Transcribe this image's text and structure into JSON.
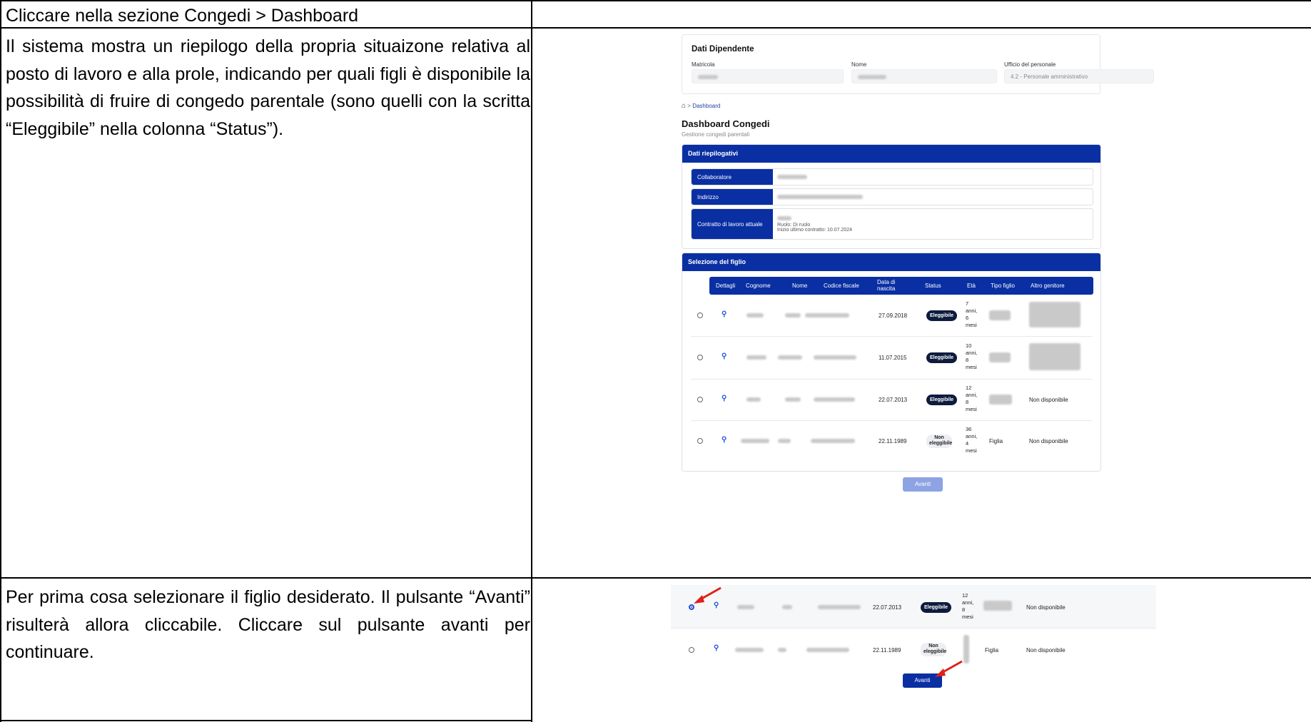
{
  "doc": {
    "header_instruction": "Cliccare nella sezione Congedi > Dashboard",
    "step1_text": "Il sistema mostra un riepilogo della propria situaizone relativa al posto di lavoro e alla prole, indicando per quali figli è disponibile la possibilità di fruire di congedo parentale (sono quelli con la scritta “Eleggibile” nella colonna “Status”).",
    "step2_text": "Per prima cosa selezionare il figlio desiderato. Il pulsante “Avanti” risulterà allora cliccabile. Cliccare sul pulsante avanti per continuare."
  },
  "employee": {
    "title": "Dati Dipendente",
    "matricola_label": "Matricola",
    "nome_label": "Nome",
    "ufficio_label": "Ufficio del personale",
    "ufficio_value": "4.2 - Personale amministrativo"
  },
  "breadcrumb": {
    "current": "Dashboard"
  },
  "page": {
    "title": "Dashboard Congedi",
    "subtitle": "Gestione congedi parentali"
  },
  "summary": {
    "title": "Dati riepilogativi",
    "collaboratore_label": "Collaboratore",
    "indirizzo_label": "Indirizzo",
    "contratto_label": "Contratto di lavoro attuale",
    "ruolo": "Ruolo: Di ruolo",
    "inizio_contratto": "Inizio ultimo contratto: 10.07.2024"
  },
  "children": {
    "title": "Selezione del figlio",
    "columns": {
      "dettagli": "Dettagli",
      "cognome": "Cognome",
      "nome": "Nome",
      "codice_fiscale": "Codice fiscale",
      "data_nascita": "Data di nascita",
      "status": "Status",
      "eta": "Età",
      "tipo_figlio": "Tipo figlio",
      "altro_genitore": "Altro genitore"
    },
    "rows": [
      {
        "data_nascita": "27.09.2018",
        "status": "Eleggibile",
        "eta": [
          "7",
          "anni,",
          "6",
          "mesi"
        ],
        "tipo_figlio": "",
        "altro_genitore": ""
      },
      {
        "data_nascita": "11.07.2015",
        "status": "Eleggibile",
        "eta": [
          "10",
          "anni,",
          "8",
          "mesi"
        ],
        "tipo_figlio": "",
        "altro_genitore": ""
      },
      {
        "data_nascita": "22.07.2013",
        "status": "Eleggibile",
        "eta": [
          "12",
          "anni,",
          "8",
          "mesi"
        ],
        "tipo_figlio": "",
        "altro_genitore": "Non disponibile"
      },
      {
        "data_nascita": "22.11.1989",
        "status": "Non eleggibile",
        "eta": [
          "36",
          "anni,",
          "4",
          "mesi"
        ],
        "tipo_figlio": "Figlia",
        "altro_genitore": "Non disponibile"
      }
    ],
    "next_button": "Avanti"
  },
  "shot2": {
    "rows": [
      {
        "data_nascita": "22.07.2013",
        "status": "Eleggibile",
        "eta": [
          "12",
          "anni,",
          "8",
          "mesi"
        ],
        "altro_genitore": "Non disponibile",
        "selected": true
      },
      {
        "data_nascita": "22.11.1989",
        "status": "Non eleggibile",
        "tipo_figlio": "Figlia",
        "altro_genitore": "Non disponibile",
        "selected": false
      }
    ],
    "next_button": "Avanti"
  }
}
